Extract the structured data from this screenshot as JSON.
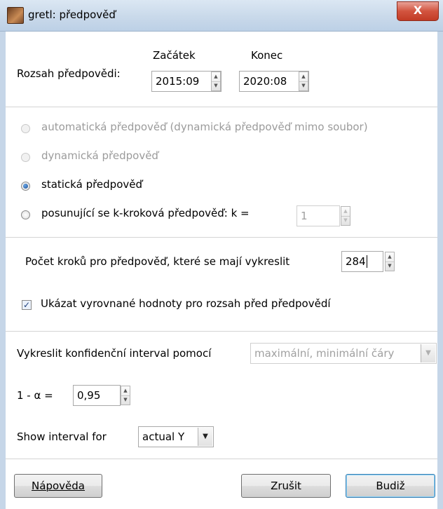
{
  "window": {
    "title": "gretl: předpověď",
    "close_glyph": "X"
  },
  "range": {
    "label": "Rozsah předpovědi:",
    "start_header": "Začátek",
    "end_header": "Konec",
    "start_value": "2015:09",
    "end_value": "2020:08"
  },
  "forecast_type": {
    "options": [
      {
        "label": "automatická předpověď (dynamická předpověď mimo soubor)",
        "selected": false,
        "enabled": false
      },
      {
        "label": "dynamická předpověď",
        "selected": false,
        "enabled": false
      },
      {
        "label": "statická předpověď",
        "selected": true,
        "enabled": true
      },
      {
        "label": "posunující se k-kroková předpověď: k =",
        "selected": false,
        "enabled": true
      }
    ],
    "k_value": "1"
  },
  "plot_steps": {
    "label": "Počet kroků pro předpověď, které se mají vykreslit",
    "value": "284"
  },
  "show_fitted": {
    "label": "Ukázat vyrovnané hodnoty pro rozsah před předpovědí",
    "checked": true
  },
  "confidence": {
    "label": "Vykreslit konfidenční interval pomocí",
    "method_value": "maximální, minimální čáry",
    "alpha_label": "1 - α =",
    "alpha_value": "0,95"
  },
  "interval": {
    "label": "Show interval for",
    "value": "actual Y"
  },
  "buttons": {
    "help": "Nápověda",
    "cancel": "Zrušit",
    "ok": "Budiž"
  }
}
